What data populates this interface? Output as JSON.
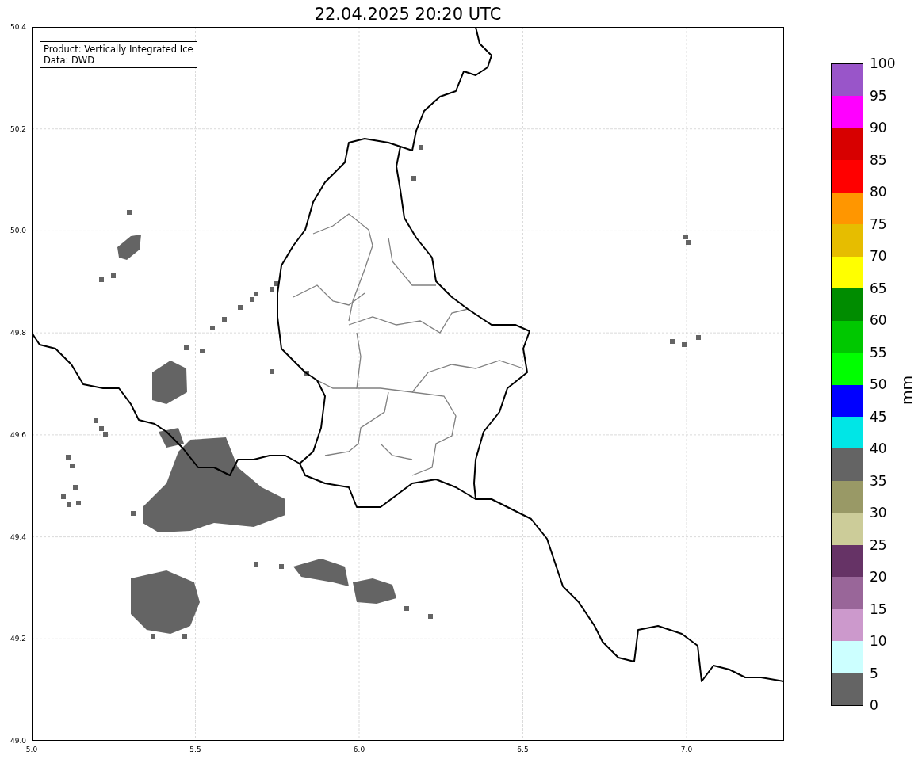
{
  "title": "22.04.2025 20:20 UTC",
  "map": {
    "info_box": [
      "Product: Vertically Integrated Ice",
      "Data: DWD"
    ],
    "xticks": [
      "5.0",
      "5.5",
      "6.0",
      "6.5",
      "7.0"
    ],
    "yticks": [
      "50.4",
      "50.2",
      "50.0",
      "49.8",
      "49.6",
      "49.4",
      "49.2",
      "49.0"
    ]
  },
  "colorbar": {
    "label": "mm",
    "bins": [
      {
        "color": "#9955c9"
      },
      {
        "color": "#ff00ff"
      },
      {
        "color": "#d70000"
      },
      {
        "color": "#ff0000"
      },
      {
        "color": "#ff9600"
      },
      {
        "color": "#e6bd00"
      },
      {
        "color": "#ffff00"
      },
      {
        "color": "#008c00"
      },
      {
        "color": "#00c800"
      },
      {
        "color": "#00ff00"
      },
      {
        "color": "#0000ff"
      },
      {
        "color": "#00e6e6"
      },
      {
        "color": "#646464"
      },
      {
        "color": "#999966"
      },
      {
        "color": "#cccc99"
      },
      {
        "color": "#663366"
      },
      {
        "color": "#996699"
      },
      {
        "color": "#cc99cc"
      },
      {
        "color": "#ccffff"
      },
      {
        "color": "#646464"
      }
    ],
    "ticks": [
      "100",
      "95",
      "90",
      "85",
      "80",
      "75",
      "70",
      "65",
      "60",
      "55",
      "50",
      "45",
      "40",
      "35",
      "30",
      "25",
      "20",
      "15",
      "10",
      "5",
      "0"
    ]
  }
}
